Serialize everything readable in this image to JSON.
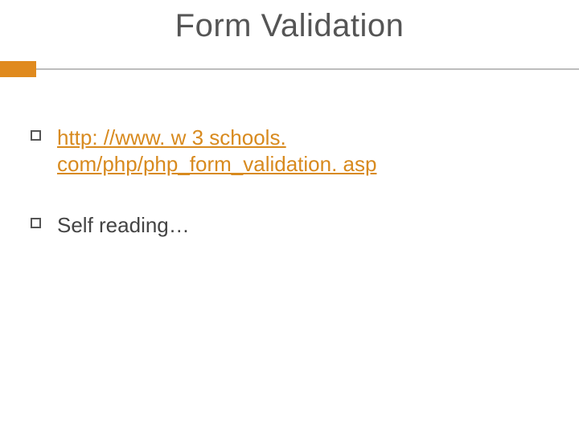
{
  "title": "Form Validation",
  "bullets": [
    {
      "text": "http: //www. w 3 schools. com/php/php_form_validation. asp",
      "is_link": true
    },
    {
      "text": "Self reading…",
      "is_link": false
    }
  ]
}
